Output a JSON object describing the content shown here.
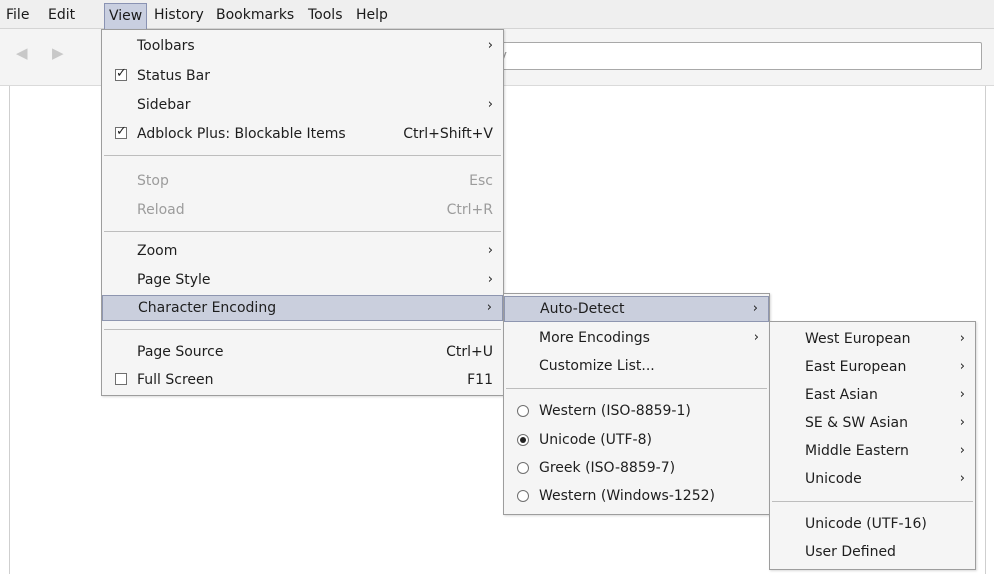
{
  "menubar": {
    "items": [
      "File",
      "Edit",
      "View",
      "History",
      "Bookmarks",
      "Tools",
      "Help"
    ]
  },
  "navbar": {
    "url_placeholder_fragment": "ry"
  },
  "view_menu": {
    "toolbars": "Toolbars",
    "status_bar": "Status Bar",
    "sidebar": "Sidebar",
    "adblock": "Adblock Plus: Blockable Items",
    "adblock_shortcut": "Ctrl+Shift+V",
    "stop": "Stop",
    "stop_shortcut": "Esc",
    "reload": "Reload",
    "reload_shortcut": "Ctrl+R",
    "zoom": "Zoom",
    "page_style": "Page Style",
    "character_encoding": "Character Encoding",
    "page_source": "Page Source",
    "page_source_shortcut": "Ctrl+U",
    "full_screen": "Full Screen",
    "full_screen_shortcut": "F11"
  },
  "encoding_menu": {
    "auto_detect": "Auto-Detect",
    "more_encodings": "More Encodings",
    "customize_list": "Customize List...",
    "western_iso": "Western (ISO-8859-1)",
    "unicode_utf8": "Unicode (UTF-8)",
    "greek": "Greek (ISO-8859-7)",
    "western_win": "Western (Windows-1252)"
  },
  "more_encodings_menu": {
    "west_european": "West European",
    "east_european": "East European",
    "east_asian": "East Asian",
    "se_sw_asian": "SE & SW Asian",
    "middle_eastern": "Middle Eastern",
    "unicode": "Unicode",
    "unicode_utf16": "Unicode (UTF-16)",
    "user_defined": "User Defined"
  },
  "icons": {
    "submenu_arrow": "›",
    "check": "✓",
    "back": "◀",
    "forward": "▶"
  }
}
